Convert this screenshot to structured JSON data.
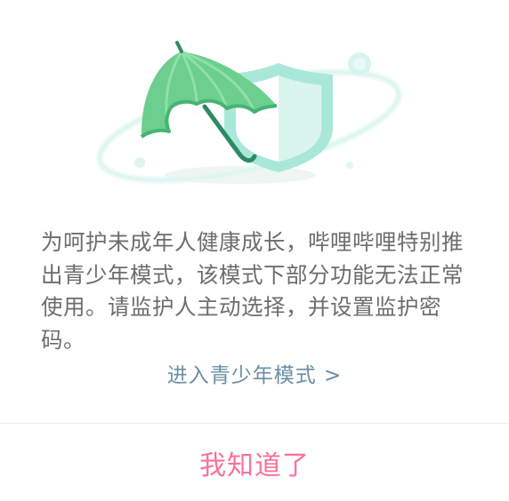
{
  "dialog": {
    "illustration": {
      "icon": "umbrella-shield-icon",
      "colors": {
        "umbrella": "#5dcc8a",
        "umbrella_dark": "#3aa868",
        "shield": "#7fd8c4",
        "orbit": "#c8f2ea"
      }
    },
    "message": "为呵护未成年人健康成长，哔哩哔哩特别推出青少年模式，该模式下部分功能无法正常使用。请监护人主动选择，并设置监护密码。",
    "enter_youth_mode_label": "进入青少年模式 >",
    "confirm_label": "我知道了",
    "colors": {
      "text": "#6d6d6d",
      "link": "#6a8ea4",
      "accent": "#fb7299"
    }
  }
}
